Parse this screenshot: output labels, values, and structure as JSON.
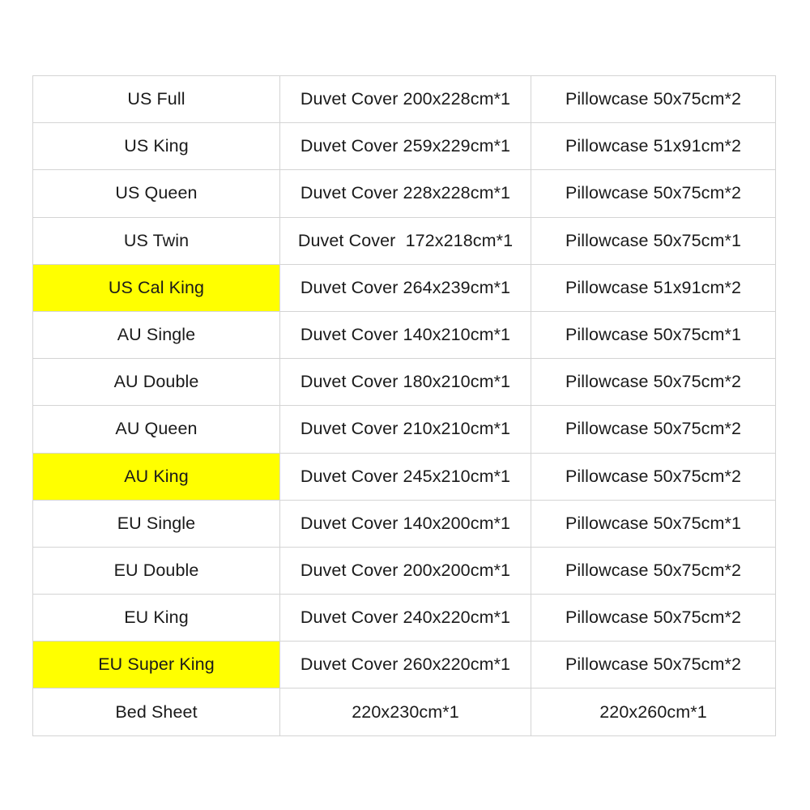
{
  "table": {
    "columns": [
      "size",
      "duvet_cover",
      "pillowcase"
    ],
    "highlight_color": "#FFFF00",
    "border_color": "#d4d4d4",
    "text_color": "#1a1a1a",
    "background_color": "#ffffff",
    "rows": [
      {
        "size": "US Full",
        "duvet_cover": "Duvet Cover 200x228cm*1",
        "pillowcase": "Pillowcase 50x75cm*2",
        "highlighted": false
      },
      {
        "size": "US King",
        "duvet_cover": "Duvet Cover 259x229cm*1",
        "pillowcase": "Pillowcase 51x91cm*2",
        "highlighted": false
      },
      {
        "size": "US Queen",
        "duvet_cover": "Duvet Cover 228x228cm*1",
        "pillowcase": "Pillowcase 50x75cm*2",
        "highlighted": false
      },
      {
        "size": "US Twin",
        "duvet_cover": "Duvet Cover  172x218cm*1",
        "pillowcase": "Pillowcase 50x75cm*1",
        "highlighted": false
      },
      {
        "size": "US Cal King",
        "duvet_cover": "Duvet Cover 264x239cm*1",
        "pillowcase": "Pillowcase 51x91cm*2",
        "highlighted": true
      },
      {
        "size": "AU Single",
        "duvet_cover": "Duvet Cover 140x210cm*1",
        "pillowcase": "Pillowcase 50x75cm*1",
        "highlighted": false
      },
      {
        "size": "AU Double",
        "duvet_cover": "Duvet Cover 180x210cm*1",
        "pillowcase": "Pillowcase 50x75cm*2",
        "highlighted": false
      },
      {
        "size": "AU Queen",
        "duvet_cover": "Duvet Cover 210x210cm*1",
        "pillowcase": "Pillowcase 50x75cm*2",
        "highlighted": false
      },
      {
        "size": "AU King",
        "duvet_cover": "Duvet Cover 245x210cm*1",
        "pillowcase": "Pillowcase 50x75cm*2",
        "highlighted": true
      },
      {
        "size": "EU Single",
        "duvet_cover": "Duvet Cover 140x200cm*1",
        "pillowcase": "Pillowcase 50x75cm*1",
        "highlighted": false
      },
      {
        "size": "EU Double",
        "duvet_cover": "Duvet Cover 200x200cm*1",
        "pillowcase": "Pillowcase 50x75cm*2",
        "highlighted": false
      },
      {
        "size": "EU King",
        "duvet_cover": "Duvet Cover 240x220cm*1",
        "pillowcase": "Pillowcase 50x75cm*2",
        "highlighted": false
      },
      {
        "size": "EU Super King",
        "duvet_cover": "Duvet Cover 260x220cm*1",
        "pillowcase": "Pillowcase 50x75cm*2",
        "highlighted": true
      },
      {
        "size": "Bed Sheet",
        "duvet_cover": "220x230cm*1",
        "pillowcase": "220x260cm*1",
        "highlighted": false
      }
    ]
  }
}
